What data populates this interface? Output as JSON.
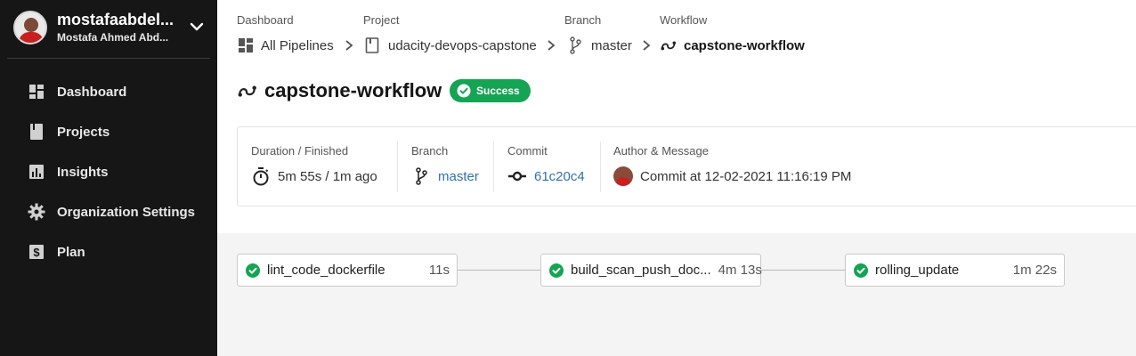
{
  "user": {
    "username": "mostafaabdel...",
    "full_name": "Mostafa Ahmed Abd..."
  },
  "sidebar": {
    "items": [
      {
        "label": "Dashboard",
        "icon": "dashboard-icon"
      },
      {
        "label": "Projects",
        "icon": "book-icon"
      },
      {
        "label": "Insights",
        "icon": "bar-chart-icon"
      },
      {
        "label": "Organization Settings",
        "icon": "gear-icon"
      },
      {
        "label": "Plan",
        "icon": "dollar-icon"
      }
    ]
  },
  "breadcrumb": {
    "labels": [
      "Dashboard",
      "Project",
      "Branch",
      "Workflow"
    ],
    "items": [
      {
        "text": "All Pipelines",
        "icon": "dashboard-icon"
      },
      {
        "text": "udacity-devops-capstone",
        "icon": "book-icon"
      },
      {
        "text": "master",
        "icon": "branch-icon"
      },
      {
        "text": "capstone-workflow",
        "icon": "workflow-icon"
      }
    ]
  },
  "workflow": {
    "name": "capstone-workflow",
    "status": "Success",
    "status_color": "#15a354"
  },
  "info": {
    "duration_label": "Duration / Finished",
    "duration_value": "5m 55s / 1m ago",
    "branch_label": "Branch",
    "branch_value": "master",
    "commit_label": "Commit",
    "commit_value": "61c20c4",
    "author_label": "Author & Message",
    "author_message": "Commit at 12-02-2021 11:16:19 PM",
    "link_color": "#2f6fb0"
  },
  "jobs": [
    {
      "name": "lint_code_dockerfile",
      "duration": "11s",
      "status": "success"
    },
    {
      "name": "build_scan_push_doc...",
      "duration": "4m 13s",
      "status": "success"
    },
    {
      "name": "rolling_update",
      "duration": "1m 22s",
      "status": "success"
    }
  ]
}
